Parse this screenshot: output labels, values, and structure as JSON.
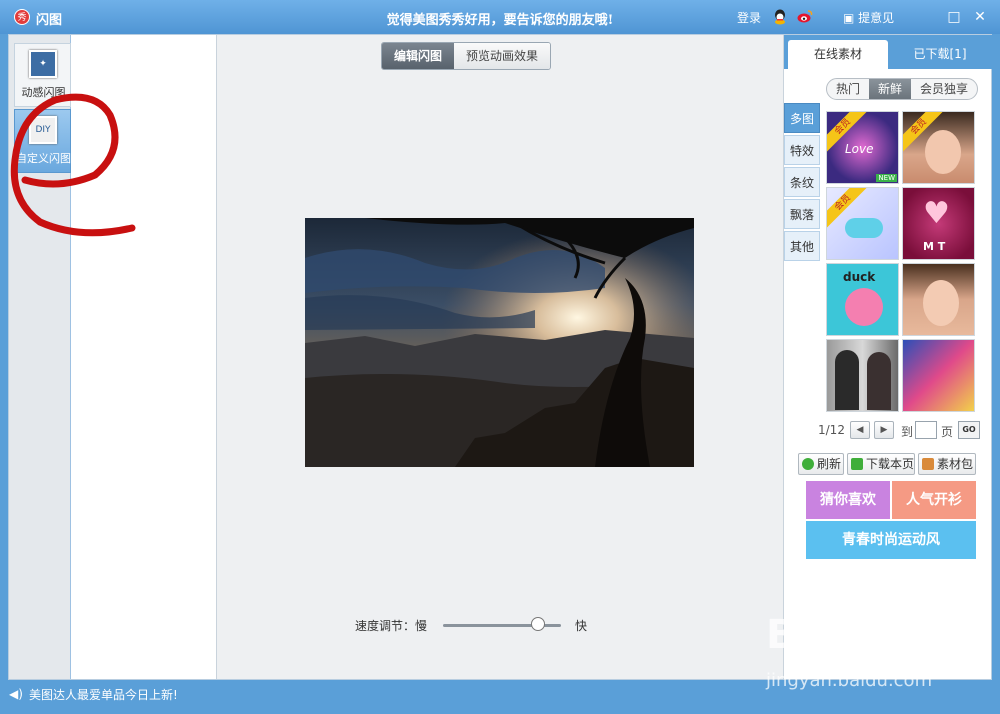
{
  "titlebar": {
    "app_title": "闪图",
    "slogan": "觉得美图秀秀好用，要告诉您的朋友哦!",
    "login": "登录",
    "feedback": "提意见",
    "logo_text": "秀"
  },
  "left_tools": [
    {
      "label": "动感闪图",
      "icon": "sparkle-frame-icon"
    },
    {
      "label": "自定义闪图",
      "icon": "diy-frame-icon",
      "icon_text": "DIY"
    }
  ],
  "canvas": {
    "mode_tabs": [
      {
        "label": "编辑闪图",
        "selected": true
      },
      {
        "label": "预览动画效果",
        "selected": false
      }
    ],
    "speed": {
      "label": "速度调节：慢",
      "fast_label": "快",
      "value": 0.85
    }
  },
  "right_panel": {
    "tabs": [
      {
        "label": "在线素材",
        "selected": true
      },
      {
        "label": "已下载[1]",
        "selected": false
      }
    ],
    "sub_tabs": [
      {
        "label": "热门",
        "selected": false
      },
      {
        "label": "新鲜",
        "selected": true
      },
      {
        "label": "会员独享",
        "selected": false
      }
    ],
    "categories": [
      {
        "label": "多图",
        "selected": true
      },
      {
        "label": "特效",
        "selected": false
      },
      {
        "label": "条纹",
        "selected": false
      },
      {
        "label": "飘落",
        "selected": false
      },
      {
        "label": "其他",
        "selected": false
      }
    ],
    "thumbnails": [
      {
        "badge": "会员",
        "extra": "NEW",
        "text": "Love"
      },
      {
        "badge": "会员",
        "extra": "",
        "text": ""
      },
      {
        "badge": "会员",
        "extra": "",
        "text": ""
      },
      {
        "badge": "",
        "extra": "",
        "text": "M T"
      },
      {
        "badge": "",
        "extra": "",
        "text": "duck"
      },
      {
        "badge": "",
        "extra": "",
        "text": ""
      },
      {
        "badge": "",
        "extra": "",
        "text": ""
      },
      {
        "badge": "",
        "extra": "",
        "text": ""
      }
    ],
    "pager": {
      "current": "1/12",
      "goto_label": "到",
      "page_label": "页",
      "go_label": "GO"
    },
    "actions": [
      {
        "label": "刷新",
        "icon": "refresh-icon"
      },
      {
        "label": "下载本页",
        "icon": "download-icon"
      },
      {
        "label": "素材包",
        "icon": "package-icon"
      }
    ],
    "promos": [
      {
        "label": "猜你喜欢",
        "color": "#c983e0"
      },
      {
        "label": "人气开衫",
        "color": "#f59a84"
      },
      {
        "label": "青春时尚运动风",
        "color": "#5bc0f0"
      }
    ]
  },
  "statusbar": {
    "text": "美图达人最爱单品今日上新!"
  },
  "watermark": {
    "brand": "Baidu经验",
    "url": "jingyan.baidu.com"
  },
  "colors": {
    "accent": "#5a9fd8",
    "annotation": "#c81010"
  }
}
